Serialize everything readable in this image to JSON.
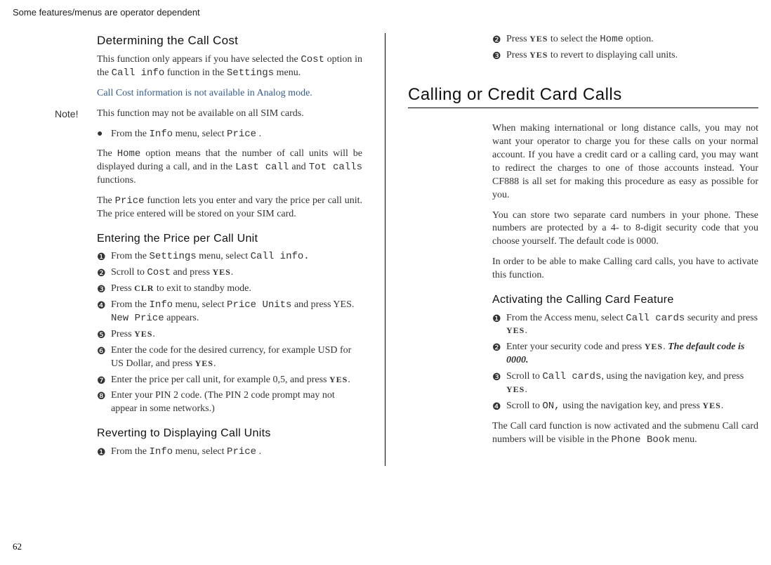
{
  "topnote": "Some features/menus are operator dependent",
  "pagenum": "62",
  "left": {
    "h1": "Determining the Call Cost",
    "p1a": "This function only appears if you have selected the ",
    "p1_cost": "Cost",
    "p1b": " option in the ",
    "p1_callinfo": "Call info",
    "p1c": " function in the ",
    "p1_settings": "Settings",
    "p1d": " menu.",
    "bluenote": "Call Cost information is not available in Analog mode.",
    "notelabel": "Note!",
    "notetext": "This function may not be available on all SIM cards.",
    "bullet1a": "From the ",
    "bullet1_info": "Info",
    "bullet1b": " menu, select ",
    "bullet1_price": "Price",
    "bullet1c": " .",
    "p2a": "The ",
    "p2_home": "Home",
    "p2b": " option means that the number of call units will be displayed during a call, and in the ",
    "p2_lastcall": "Last call",
    "p2c": " and ",
    "p2_totcalls": "Tot calls",
    "p2d": " functions.",
    "p3a": "The ",
    "p3_price": "Price",
    "p3b": " function lets you enter and vary the price per call unit. The price entered will be stored on your SIM card.",
    "h2": "Entering the Price per Call Unit",
    "s1a": "From the ",
    "s1_settings": "Settings",
    "s1b": " menu, select ",
    "s1_callinfo": "Call info.",
    "s2a": "Scroll to ",
    "s2_cost": "Cost",
    "s2b": " and press ",
    "s2_yes": "YES",
    "s2c": ".",
    "s3a": "Press ",
    "s3_clr": "CLR",
    "s3b": " to exit to standby mode.",
    "s4a": "From the ",
    "s4_info": "Info",
    "s4b": " menu, select ",
    "s4_priceunits": "Price Units",
    "s4c": " and press YES. ",
    "s4_newprice": "New Price",
    "s4d": " appears.",
    "s5a": "Press ",
    "s5_yes": "YES",
    "s5b": ".",
    "s6a": "Enter the code for the desired currency, for example USD  for US Dollar, and press ",
    "s6_yes": "YES",
    "s6b": ".",
    "s7a": "Enter the price per call unit, for example 0,5, and press ",
    "s7_yes": "YES",
    "s7b": ".",
    "s8a": "Enter your PIN 2 code. (The PIN 2 code prompt may not appear in some networks.)",
    "h3": "Reverting to Displaying Call Units",
    "r1a": "From the ",
    "r1_info": "Info",
    "r1b": " menu, select ",
    "r1_price": "Price",
    "r1c": " ."
  },
  "right": {
    "c2a": "Press ",
    "c2_yes": "YES",
    "c2b": " to select the ",
    "c2_home": "Home",
    "c2c": " option.",
    "c3a": "Press ",
    "c3_yes": "YES",
    "c3b": " to revert to displaying call units.",
    "h1": "Calling or Credit Card Calls",
    "p1": "When making international or long distance calls, you may not want your operator to charge you for these calls on your normal account. If you have a credit card or a calling card, you may want to redirect the charges to one of those accounts instead. Your CF888 is all set for making this procedure as easy as possible for you.",
    "p2": "You can store two separate card numbers in your phone. These numbers are protected by a 4- to 8-digit security code that you choose yourself. The default code is 0000.",
    "p3": "In order to be able to make Calling card calls, you have to activate this function.",
    "h2": "Activating the Calling Card Feature",
    "a1a": "From the Access menu, select ",
    "a1_callcards": "Call cards",
    "a1b": " security and press ",
    "a1_yes": "YES",
    "a1c": ".",
    "a2a": "Enter your security code and press ",
    "a2_yes": "YES",
    "a2b": ". ",
    "a2_bold": "The default code is 0000.",
    "a3a": "Scroll to ",
    "a3_callcards": "Call cards",
    "a3b": ", using the navigation key, and press ",
    "a3_yes": "YES",
    "a3c": ".",
    "a4a": "Scroll to ",
    "a4_on": "ON,",
    "a4b": " using the navigation key, and press ",
    "a4_yes": "YES",
    "a4c": ".",
    "p4a": "The Call card function is now activated and the submenu Call card numbers will be visible in the ",
    "p4_phonebook": "Phone Book",
    "p4b": " menu."
  }
}
